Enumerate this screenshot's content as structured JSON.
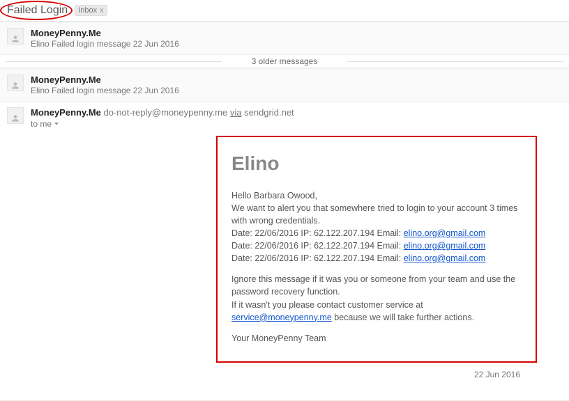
{
  "header": {
    "subject": "Failed Login",
    "label": {
      "name": "Inbox",
      "close": "x"
    }
  },
  "collapsed": [
    {
      "sender": "MoneyPenny.Me",
      "snippet": "Elino Failed login message 22 Jun 2016"
    },
    {
      "sender": "MoneyPenny.Me",
      "snippet": "Elino Failed login message 22 Jun 2016"
    }
  ],
  "older_bar": "3 older messages",
  "expanded": {
    "sender_name": "MoneyPenny.Me",
    "sender_addr": "do-not-reply@moneypenny.me",
    "via_word": "via",
    "via_host": "sendgrid.net",
    "to_line": "to me",
    "date": "22 Jun 2016",
    "body": {
      "brand": "Elino",
      "greeting": "Hello Barbara Owood,",
      "intro": "We want to alert you that somewhere tried to login to your account 3 times with wrong credentials.",
      "attempts": [
        {
          "prefix": "Date: 22/06/2016 IP: 62.122.207.194 Email: ",
          "email": "elino.org@gmail.com"
        },
        {
          "prefix": "Date: 22/06/2016 IP: 62.122.207.194 Email: ",
          "email": "elino.org@gmail.com"
        },
        {
          "prefix": "Date: 22/06/2016 IP: 62.122.207.194 Email: ",
          "email": "elino.org@gmail.com"
        }
      ],
      "ignore": "Ignore this message if it was you or someone from your team and use the password recovery function.",
      "contact_pre": "If it wasn't you please contact customer service at ",
      "contact_email": "service@moneypenny.me",
      "contact_post": " because we will take further actions.",
      "signoff": "Your MoneyPenny Team"
    }
  }
}
